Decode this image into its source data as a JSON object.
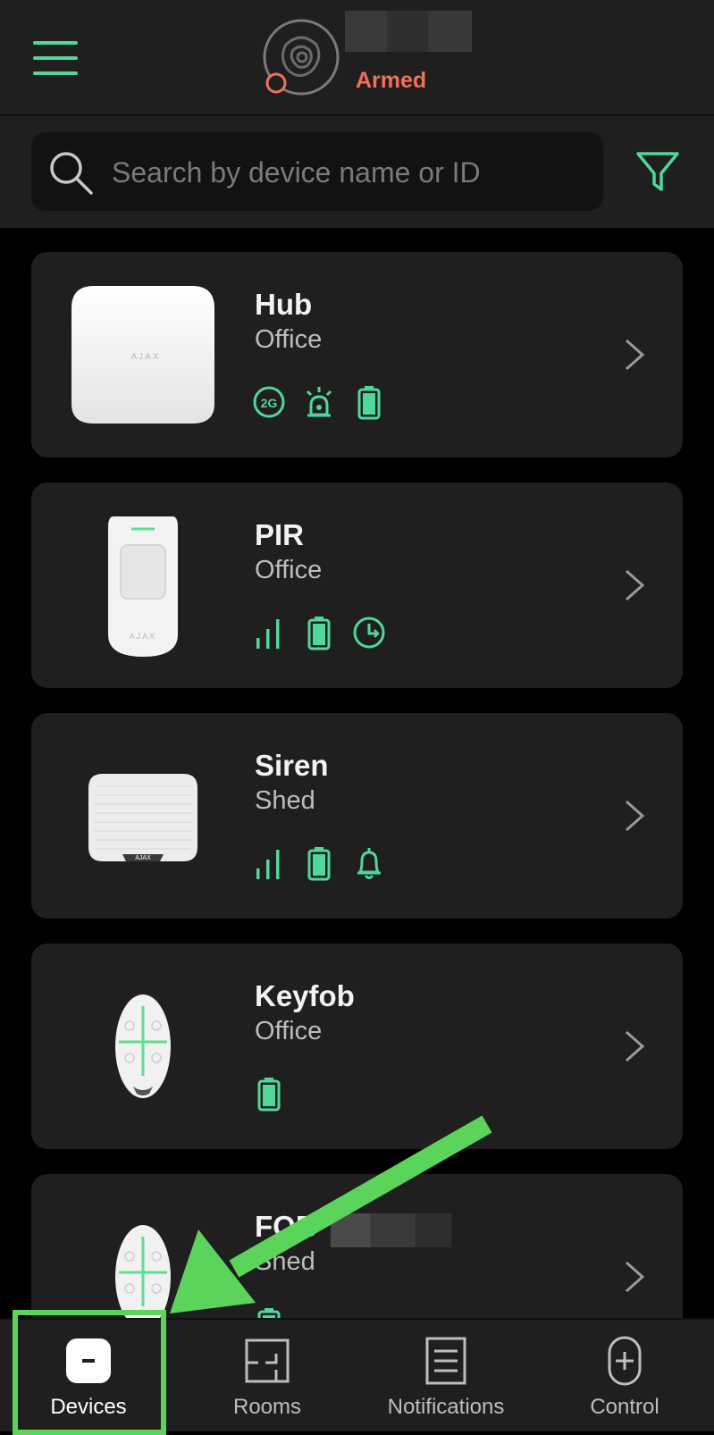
{
  "header": {
    "status": "Armed",
    "menu_icon": "hamburger-menu-icon",
    "hub_logo_icon": "hub-shield-icon"
  },
  "search": {
    "placeholder": "Search by device name or ID",
    "value": ""
  },
  "filter": {
    "icon": "filter-icon"
  },
  "devices": [
    {
      "name": "Hub",
      "room": "Office",
      "status_icons": [
        "2g-icon",
        "alarm-siren-icon",
        "battery-icon"
      ]
    },
    {
      "name": "PIR",
      "room": "Office",
      "status_icons": [
        "signal-strength-icon",
        "battery-icon",
        "delay-timer-icon"
      ]
    },
    {
      "name": "Siren",
      "room": "Shed",
      "status_icons": [
        "signal-strength-icon",
        "battery-icon",
        "bell-icon"
      ]
    },
    {
      "name": "Keyfob",
      "room": "Office",
      "status_icons": [
        "battery-icon"
      ]
    },
    {
      "name": "FOB",
      "room": "Shed",
      "status_icons": [
        "battery-icon"
      ]
    }
  ],
  "bottom_nav": {
    "tabs": [
      {
        "label": "Devices",
        "icon": "devices-icon",
        "active": true
      },
      {
        "label": "Rooms",
        "icon": "rooms-icon",
        "active": false
      },
      {
        "label": "Notifications",
        "icon": "notifications-icon",
        "active": false
      },
      {
        "label": "Control",
        "icon": "control-icon",
        "active": false
      }
    ]
  },
  "colors": {
    "accent": "#4fd89a",
    "armed": "#f0705a",
    "annotation": "#5bd45b",
    "background": "#000000",
    "card": "#1f1f1f"
  }
}
